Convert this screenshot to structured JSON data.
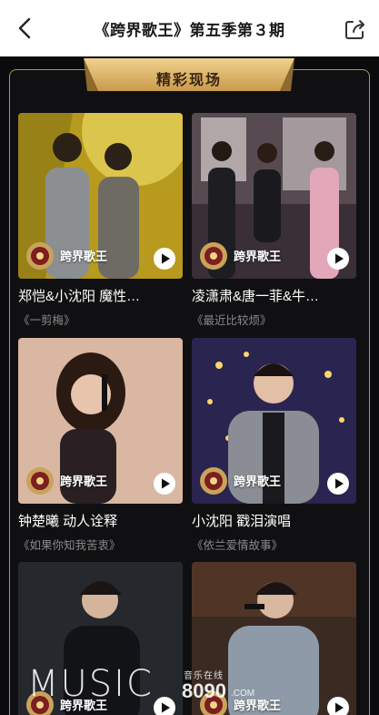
{
  "header": {
    "title": "《跨界歌王》第五季第３期",
    "back_icon": "chevron-left-icon",
    "share_icon": "share-icon"
  },
  "section": {
    "title": "精彩现场"
  },
  "colors": {
    "gold": "#b8924a",
    "background": "#0b0b0d",
    "banner": "#d9b36a"
  },
  "cards": [
    {
      "brand": "跨界歌王",
      "title": "郑恺&小沈阳 魔性…",
      "subtitle": "《一剪梅》"
    },
    {
      "brand": "跨界歌王",
      "title": "凌潇肃&唐一菲&牛…",
      "subtitle": "《最近比较烦》"
    },
    {
      "brand": "跨界歌王",
      "title": "钟楚曦 动人诠释",
      "subtitle": "《如果你知我苦衷》"
    },
    {
      "brand": "跨界歌王",
      "title": "小沈阳 戳泪演唱",
      "subtitle": "《依兰爱情故事》"
    },
    {
      "brand": "跨界歌王",
      "title": "",
      "subtitle": ""
    },
    {
      "brand": "跨界歌王",
      "title": "",
      "subtitle": ""
    }
  ],
  "watermark": {
    "music": "MUSIC",
    "cn": "音乐在线",
    "num": "8090",
    "com": ".COM"
  }
}
